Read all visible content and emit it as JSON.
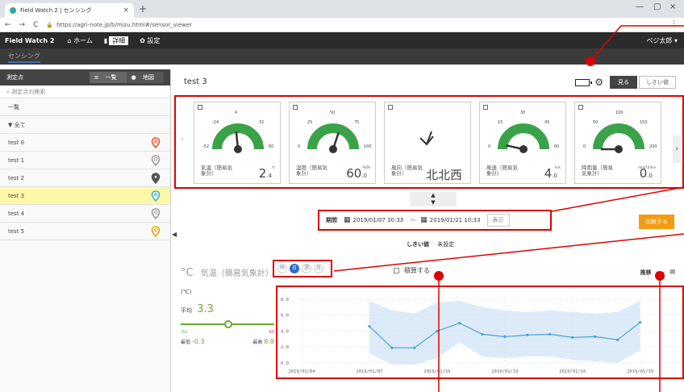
{
  "browser": {
    "tab_title": "Field Watch 2 | センシング",
    "url": "https://agri-note.jp/b/mizu.html#/sensor_viewer"
  },
  "app": {
    "brand": "Field Watch 2",
    "nav": [
      {
        "label": "ホーム"
      },
      {
        "label": "詳細"
      },
      {
        "label": "設定"
      }
    ],
    "user": "ベジ太郎",
    "sub_tab": "センシング"
  },
  "sidebar": {
    "title": "測定点",
    "view_list": "一覧",
    "view_map": "地図",
    "search_placeholder": "測定点の検索",
    "list_label": "一覧",
    "group_label": "▼ 全て",
    "items": [
      {
        "label": "test 0",
        "pin_color": "#e05a3a"
      },
      {
        "label": "test 1",
        "pin_color": "#999999"
      },
      {
        "label": "test 2",
        "pin_color": "#555555"
      },
      {
        "label": "test 3",
        "pin_color": "#3bb4c4"
      },
      {
        "label": "test 4",
        "pin_color": "#999999"
      },
      {
        "label": "test 5",
        "pin_color": "#e0a020"
      }
    ],
    "selected_index": 3
  },
  "main": {
    "title": "test 3",
    "btn_view": "見る",
    "btn_threshold": "しきい値",
    "cards": [
      {
        "label": "気温（簡易気象計）",
        "value": "2",
        "decimal": ".4",
        "unit": "℃",
        "ticks": [
          "-24",
          "4",
          "32",
          "-52",
          "60"
        ],
        "fraction": 0.47
      },
      {
        "label": "湿度（簡易気象計）",
        "value": "60",
        "decimal": ".0",
        "unit": "%RH",
        "ticks": [
          "25",
          "50",
          "75",
          "0",
          "100"
        ],
        "fraction": 0.6
      },
      {
        "label": "風向（簡易気象計）",
        "value": "北北西",
        "decimal": "",
        "unit": "",
        "ticks": [],
        "fraction": 0
      },
      {
        "label": "風速（簡易気象計）",
        "value": "4",
        "decimal": ".0",
        "unit": "m/s",
        "ticks": [
          "15",
          "30",
          "45",
          "0",
          "60"
        ],
        "fraction": 0.07
      },
      {
        "label": "降雨量（簡易気象計）",
        "value": "0",
        "decimal": ".0",
        "unit": "mm/10min",
        "ticks": [
          "50",
          "100",
          "150",
          "0",
          "200"
        ],
        "fraction": 0.0
      }
    ],
    "period": {
      "label": "期間",
      "start": "2019/01/07 10:33",
      "sep": "〜",
      "end": "2019/01/21 10:33",
      "show_btn": "表示"
    },
    "compare_btn": "比較する",
    "threshold": {
      "label": "しきい値",
      "value": "未設定"
    },
    "series_unit": "°C",
    "series_name": "気温（簡易気象計）",
    "toggles": [
      "時",
      "日",
      "週",
      "月"
    ],
    "toggle_selected": 1,
    "cumulative_label": "積算する",
    "trend_label": "推移",
    "stats": {
      "unit": "(℃)",
      "avg_label": "平均",
      "avg": "3.3",
      "range_min": "-52",
      "range_max": "60",
      "min_label": "最低",
      "min": "-0.3",
      "max_label": "最高",
      "max": "8.9"
    }
  },
  "chart_data": {
    "type": "line",
    "x": [
      "2019/01/07",
      "2019/01/08",
      "2019/01/09",
      "2019/01/10",
      "2019/01/11",
      "2019/01/12",
      "2019/01/13",
      "2019/01/14",
      "2019/01/15",
      "2019/01/16",
      "2019/01/17",
      "2019/01/18",
      "2019/01/19"
    ],
    "series": [
      {
        "values": [
          4.6,
          1.9,
          1.9,
          4.0,
          5.0,
          3.6,
          3.3,
          3.5,
          3.6,
          3.2,
          3.3,
          2.9,
          5.1
        ]
      }
    ],
    "band_upper": [
      7.8,
      6.6,
      6.2,
      7.6,
      7.8,
      7.0,
      6.6,
      6.4,
      6.6,
      6.4,
      6.2,
      6.4,
      7.8
    ],
    "band_lower": [
      1.2,
      -0.2,
      -0.2,
      0.6,
      2.6,
      0.8,
      0.6,
      0.8,
      0.8,
      0.4,
      0.2,
      0.0,
      1.6
    ],
    "tick_labels_x": [
      "2019/01/04",
      "2019/01/07",
      "2019/01/10",
      "2019/01/13",
      "2019/01/16",
      "2019/01/19"
    ],
    "y_ticks": [
      "0.0",
      "2.0",
      "4.0",
      "6.0",
      "8.0"
    ],
    "ylim": [
      0,
      8.5
    ],
    "xlim": [
      "2019/01/04",
      "2019/01/19"
    ],
    "grid": true,
    "colors": {
      "line": "#4aa0d8",
      "band": "#cfe3f6"
    }
  }
}
